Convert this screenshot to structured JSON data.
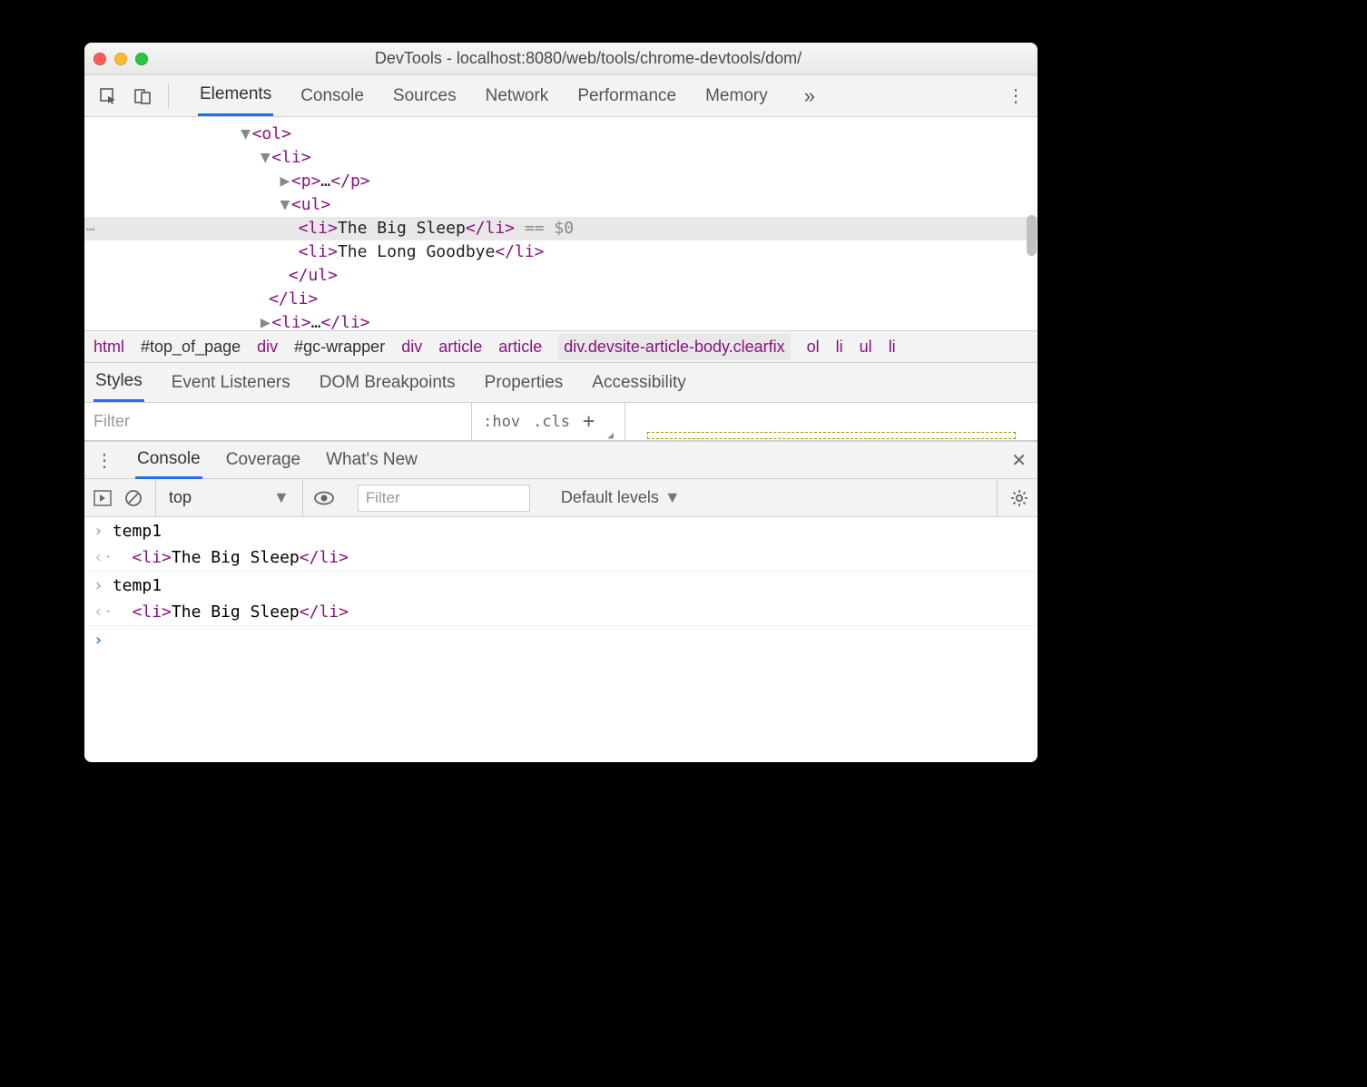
{
  "window": {
    "title": "DevTools - localhost:8080/web/tools/chrome-devtools/dom/"
  },
  "tabs": {
    "items": [
      "Elements",
      "Console",
      "Sources",
      "Network",
      "Performance",
      "Memory"
    ],
    "active": "Elements"
  },
  "dom": {
    "lines": [
      {
        "indent": 160,
        "caret": "▼",
        "open": "<ol>"
      },
      {
        "indent": 184,
        "caret": "▼",
        "open": "<li>"
      },
      {
        "indent": 208,
        "caret": "▶",
        "open": "<p>",
        "mid": "…",
        "close": "</p>"
      },
      {
        "indent": 208,
        "caret": "▼",
        "open": "<ul>"
      },
      {
        "indent": 236,
        "selected": true,
        "open": "<li>",
        "text": "The Big Sleep",
        "close": "</li>",
        "ann": " == $0"
      },
      {
        "indent": 236,
        "open": "<li>",
        "text": "The Long Goodbye",
        "close": "</li>"
      },
      {
        "indent": 218,
        "open": "</ul>"
      },
      {
        "indent": 194,
        "open": "</li>"
      },
      {
        "indent": 184,
        "caret": "▶",
        "open": "<li>",
        "mid": "…",
        "close": "</li>"
      }
    ]
  },
  "breadcrumb": [
    {
      "t": "html",
      "cls": "bc"
    },
    {
      "t": "#top_of_page",
      "cls": "bc id"
    },
    {
      "t": "div",
      "cls": "bc"
    },
    {
      "t": "#gc-wrapper",
      "cls": "bc id"
    },
    {
      "t": "div",
      "cls": "bc"
    },
    {
      "t": "article",
      "cls": "bc"
    },
    {
      "t": "article",
      "cls": "bc"
    },
    {
      "t": "div.devsite-article-body.clearfix",
      "cls": "bc hl"
    },
    {
      "t": "ol",
      "cls": "bc"
    },
    {
      "t": "li",
      "cls": "bc"
    },
    {
      "t": "ul",
      "cls": "bc"
    },
    {
      "t": "li",
      "cls": "bc"
    }
  ],
  "styles_tabs": {
    "items": [
      "Styles",
      "Event Listeners",
      "DOM Breakpoints",
      "Properties",
      "Accessibility"
    ],
    "active": "Styles"
  },
  "styles_filter": {
    "placeholder": "Filter",
    "hov": ":hov",
    "cls": ".cls"
  },
  "drawer": {
    "tabs": [
      "Console",
      "Coverage",
      "What's New"
    ],
    "active": "Console"
  },
  "console_toolbar": {
    "context": "top",
    "filter_placeholder": "Filter",
    "levels": "Default levels"
  },
  "console": {
    "rows": [
      {
        "k": "in",
        "text": "temp1"
      },
      {
        "k": "out",
        "open": "<li>",
        "text": "The Big Sleep",
        "close": "</li>"
      },
      {
        "k": "in",
        "text": "temp1"
      },
      {
        "k": "out",
        "open": "<li>",
        "text": "The Big Sleep",
        "close": "</li>"
      }
    ]
  }
}
